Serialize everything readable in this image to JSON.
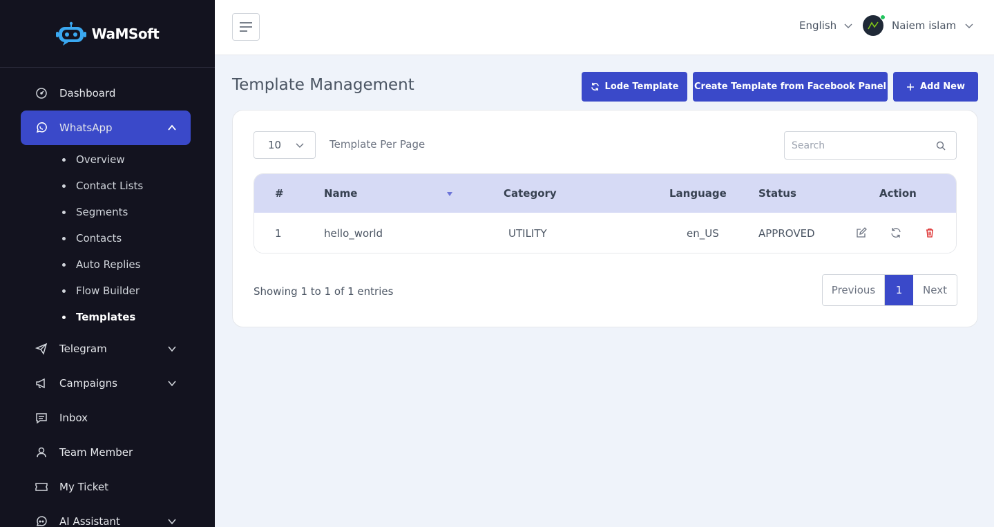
{
  "brand": {
    "name": "WaMSoft"
  },
  "sidebar": {
    "items": [
      {
        "label": "Dashboard",
        "icon": "gauge-icon"
      },
      {
        "label": "WhatsApp",
        "icon": "whatsapp-icon",
        "active": true,
        "expanded": true
      },
      {
        "label": "Telegram",
        "icon": "telegram-icon"
      },
      {
        "label": "Campaigns",
        "icon": "megaphone-icon"
      },
      {
        "label": "Inbox",
        "icon": "message-icon"
      },
      {
        "label": "Team Member",
        "icon": "user-icon"
      },
      {
        "label": "My Ticket",
        "icon": "ticket-icon"
      },
      {
        "label": "AI Assistant",
        "icon": "robot-chat-icon"
      }
    ],
    "whatsapp_sub": [
      "Overview",
      "Contact Lists",
      "Segments",
      "Contacts",
      "Auto Replies",
      "Flow Builder",
      "Templates"
    ],
    "current_sub": "Templates"
  },
  "topbar": {
    "language": "English",
    "user_name": "Naiem islam"
  },
  "page": {
    "title": "Template Management",
    "buttons": {
      "lode": "Lode Template",
      "facebook": "Create Template from Facebook Panel",
      "add": "Add New"
    }
  },
  "table_controls": {
    "per_page_value": "10",
    "per_page_label": "Template Per Page",
    "search_placeholder": "Search"
  },
  "table": {
    "headers": {
      "num": "#",
      "name": "Name",
      "category": "Category",
      "language": "Language",
      "status": "Status",
      "action": "Action"
    },
    "rows": [
      {
        "num": "1",
        "name": "hello_world",
        "category": "UTILITY",
        "language": "en_US",
        "status": "APPROVED"
      }
    ]
  },
  "footer": {
    "entries": "Showing 1 to 1 of 1 entries",
    "prev": "Previous",
    "page": "1",
    "next": "Next"
  },
  "colors": {
    "sidebar_bg": "#13131f",
    "accent": "#3a49c9",
    "table_header_bg": "#d6daf5",
    "delete": "#dc2626",
    "online": "#22c55e"
  }
}
